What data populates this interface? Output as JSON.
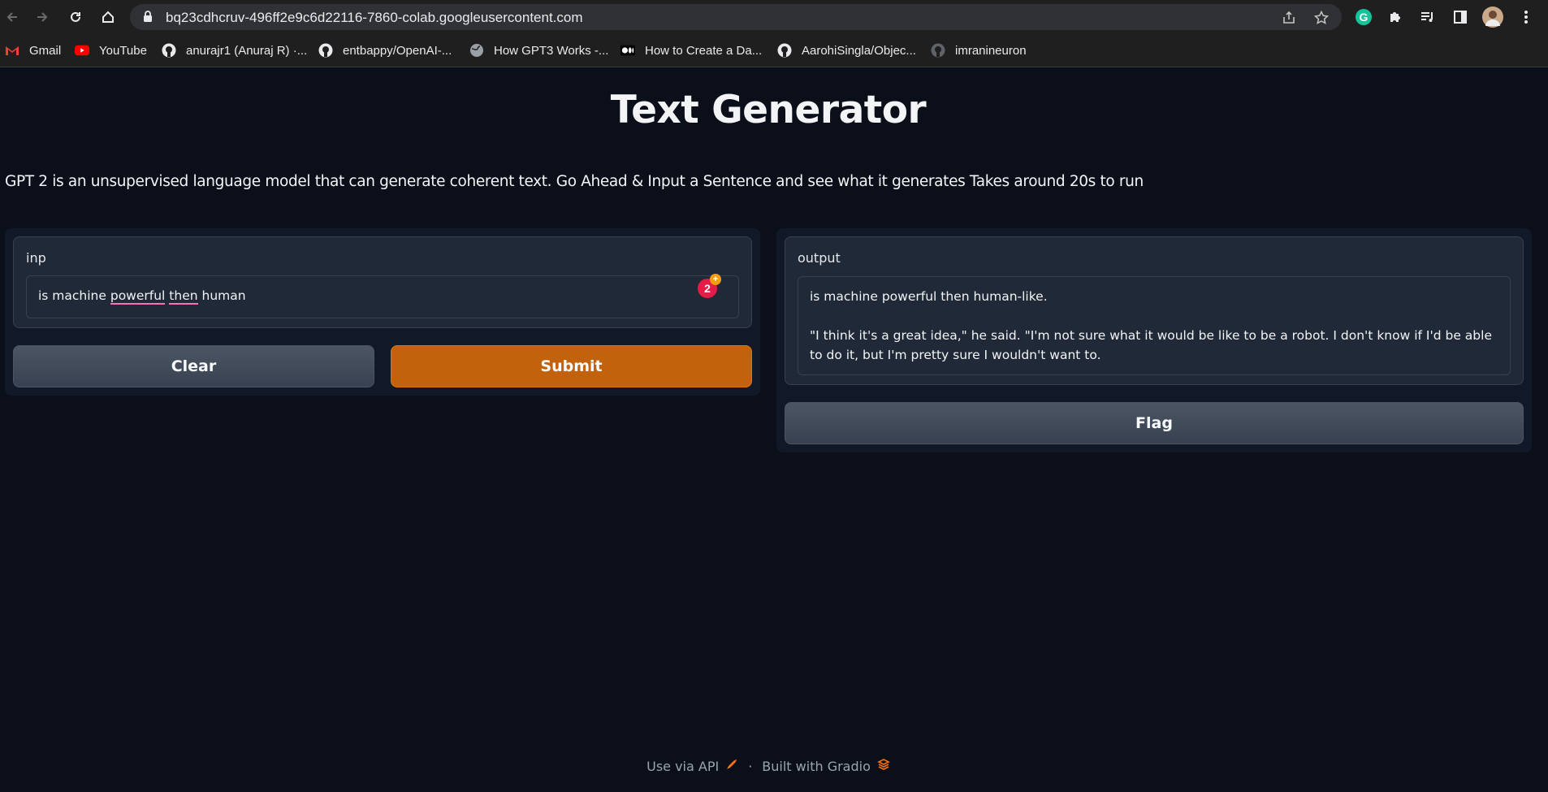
{
  "browser": {
    "url": "bq23cdhcruv-496ff2e9c6d22116-7860-colab.googleusercontent.com",
    "bookmarks": [
      {
        "label": "Gmail",
        "icon": "gmail-icon"
      },
      {
        "label": "YouTube",
        "icon": "youtube-icon"
      },
      {
        "label": "anurajr1 (Anuraj R) ·...",
        "icon": "github-icon"
      },
      {
        "label": "entbappy/OpenAI-...",
        "icon": "github-icon"
      },
      {
        "label": "How GPT3 Works -...",
        "icon": "globe-icon"
      },
      {
        "label": "How to Create a Da...",
        "icon": "medium-icon"
      },
      {
        "label": "AarohiSingla/Objec...",
        "icon": "github-icon"
      },
      {
        "label": "imranineuron",
        "icon": "github-icon"
      }
    ]
  },
  "app": {
    "title": "Text Generator",
    "description": "GPT 2 is an unsupervised language model that can generate coherent text. Go Ahead & Input a Sentence and see what it generates Takes around 20s to run"
  },
  "input": {
    "label": "inp",
    "value_parts": [
      "is machine ",
      "powerful",
      " ",
      "then",
      " human"
    ],
    "grammarly_count": "2"
  },
  "buttons": {
    "clear": "Clear",
    "submit": "Submit",
    "flag": "Flag"
  },
  "output": {
    "label": "output",
    "line1": "is machine powerful then human-like.",
    "line2": "\"I think it's a great idea,\" he said. \"I'm not sure what it would be like to be a robot. I don't know if I'd be able to do it, but I'm pretty sure I wouldn't want to."
  },
  "footer": {
    "api": "Use via API",
    "sep": "·",
    "built": "Built with Gradio"
  },
  "colors": {
    "background": "#0b0f19",
    "primary": "#c2620c",
    "panel": "#111827"
  }
}
